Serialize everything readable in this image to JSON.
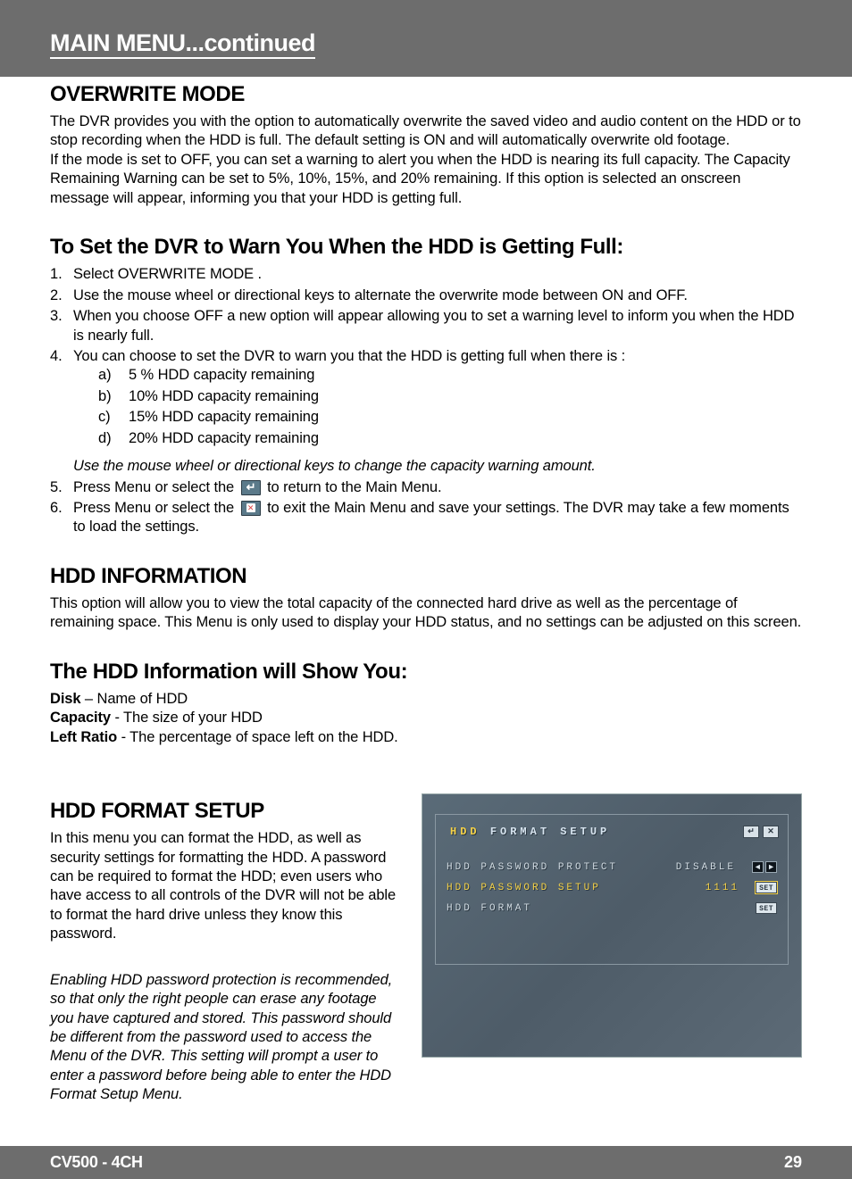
{
  "header": {
    "title": "MAIN MENU...continued"
  },
  "sections": {
    "overwrite": {
      "heading": "OVERWRITE MODE",
      "p1": "The DVR provides you with the option to automatically overwrite the saved video and audio content on the HDD or to stop recording when the HDD is full. The default setting is ON and will automatically overwrite old footage.",
      "p2": "If the mode is set to OFF, you can set a warning to alert you when the HDD is nearing its full capacity. The Capacity Remaining Warning can be set to 5%, 10%, 15%, and 20% remaining. If this option is selected an onscreen message will appear, informing you that your HDD is getting full."
    },
    "setWarn": {
      "heading": "To Set the DVR to Warn You When the HDD is Getting Full:",
      "steps": [
        "Select OVERWRITE MODE .",
        "Use the mouse wheel or directional keys to alternate the overwrite mode between ON and OFF.",
        "When you choose OFF a new option will appear allowing you to set a warning level to inform you when the HDD is nearly full.",
        "You can choose to set the DVR to warn you that the HDD is getting full when there is :"
      ],
      "sub": [
        "5 % HDD capacity remaining",
        "10% HDD capacity remaining",
        "15% HDD capacity remaining",
        "20% HDD capacity remaining"
      ],
      "note": "Use the mouse wheel or directional keys to change the capacity warning amount.",
      "step5a": "Press Menu or select the ",
      "step5b": " to return to the Main Menu.",
      "step6a": "Press Menu or select the ",
      "step6b": " to exit the Main Menu and save your settings. The DVR may take a few moments to load the settings."
    },
    "hddInfo": {
      "heading": "HDD INFORMATION",
      "p": "This option will allow you to view the total capacity of the connected hard drive as well as the percentage of remaining space. This Menu is only used to display your HDD status, and no settings can be adjusted on this screen."
    },
    "hddShow": {
      "heading": "The HDD Information will Show You:",
      "defs": [
        {
          "term": "Disk",
          "desc": " – Name of HDD"
        },
        {
          "term": "Capacity",
          "desc": " - The size of your HDD"
        },
        {
          "term": "Left Ratio",
          "desc": " - The percentage of space left on the HDD."
        }
      ]
    },
    "hddFormat": {
      "heading": "HDD FORMAT SETUP",
      "p": "In this menu you can format the HDD, as well as security settings for formatting the HDD. A password can be required to format the HDD; even users who have access to all controls of the DVR will not be able to format the hard drive unless they know this password.",
      "note": "Enabling HDD password protection is recommended, so that only the right people can erase any footage you have captured and stored. This password should be different from the password used to access the Menu of the DVR. This setting will prompt a user to enter a password before being able to enter the HDD Format Setup Menu."
    }
  },
  "dvr": {
    "title_hi": "HDD",
    "title_rest": "FORMAT SETUP",
    "rows": [
      {
        "label": "HDD PASSWORD PROTECT",
        "value": "DISABLE",
        "ctrl": "arrows",
        "sel": false
      },
      {
        "label": "HDD PASSWORD SETUP",
        "value": "1111",
        "ctrl": "set",
        "sel": true
      },
      {
        "label": "HDD FORMAT",
        "value": "",
        "ctrl": "set",
        "sel": false
      }
    ],
    "set_label": "SET"
  },
  "footer": {
    "model": "CV500 - 4CH",
    "page": "29"
  }
}
